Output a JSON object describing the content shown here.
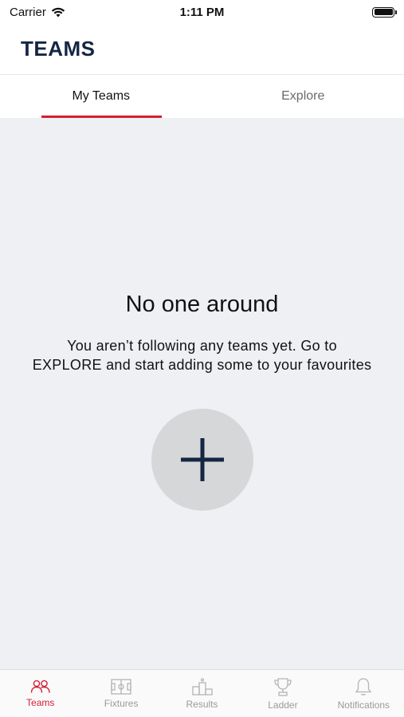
{
  "status_bar": {
    "carrier": "Carrier",
    "time": "1:11 PM"
  },
  "header": {
    "title": "TEAMS"
  },
  "tabs": [
    {
      "label": "My Teams",
      "active": true
    },
    {
      "label": "Explore",
      "active": false
    }
  ],
  "empty_state": {
    "title": "No one around",
    "message": "You aren’t following any teams yet. Go to EXPLORE and start adding some to your favourites"
  },
  "tab_bar": {
    "items": [
      {
        "label": "Teams",
        "icon": "teams-icon",
        "active": true
      },
      {
        "label": "Fixtures",
        "icon": "fixtures-icon",
        "active": false
      },
      {
        "label": "Results",
        "icon": "results-icon",
        "active": false
      },
      {
        "label": "Ladder",
        "icon": "ladder-icon",
        "active": false
      },
      {
        "label": "Notifications",
        "icon": "notifications-icon",
        "active": false
      }
    ]
  },
  "colors": {
    "accent": "#d21f34",
    "title": "#142643",
    "background": "#eff0f3"
  }
}
